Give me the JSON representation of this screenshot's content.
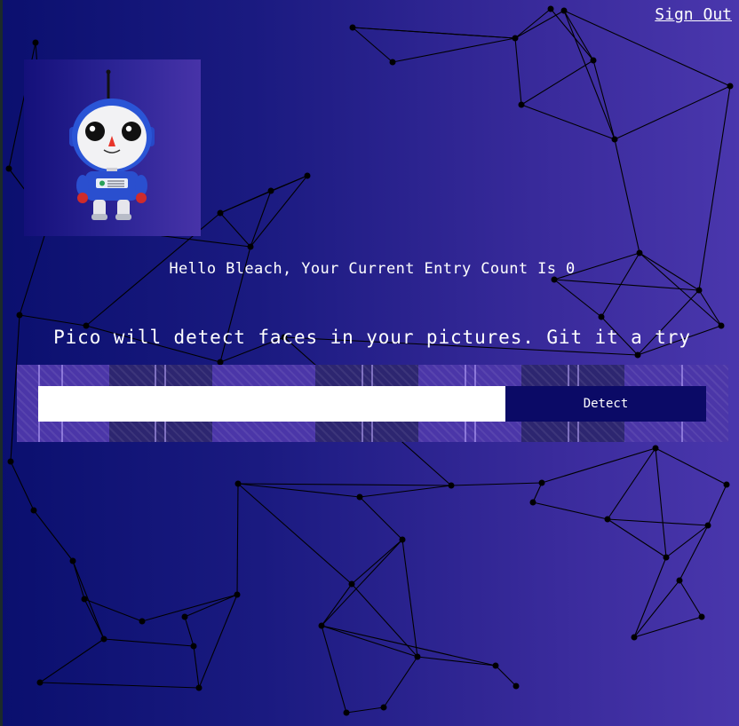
{
  "nav": {
    "sign_out": "Sign Out"
  },
  "logo": {
    "icon": "robot-icon"
  },
  "greeting": "Hello Bleach, Your Current Entry Count Is 0",
  "tagline": "Pico will detect faces in your pictures. Git it a try",
  "image_form": {
    "url_value": "",
    "url_placeholder": "",
    "detect_label": "Detect"
  },
  "colors": {
    "background_start": "#0a0f6e",
    "background_end": "#4a37ad",
    "button": "#0b0a66",
    "panel_light": "#4b36a8",
    "panel_dark": "#2d2670"
  }
}
